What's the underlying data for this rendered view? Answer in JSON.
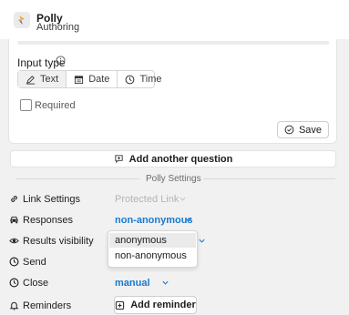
{
  "header": {
    "app_name": "Polly",
    "subtitle": "Authoring"
  },
  "question": {
    "input_type_label": "Input type",
    "input_types": [
      {
        "label": "Text",
        "icon": "pen-icon",
        "selected": true
      },
      {
        "label": "Date",
        "icon": "calendar-icon",
        "selected": false
      },
      {
        "label": "Time",
        "icon": "clock-icon",
        "selected": false
      }
    ],
    "required_label": "Required",
    "required_checked": false,
    "save_label": "Save"
  },
  "add_question_label": "Add another question",
  "settings": {
    "title": "Polly Settings",
    "rows": {
      "link_settings": {
        "label": "Link Settings",
        "value": "Protected Link"
      },
      "responses": {
        "label": "Responses",
        "value": "non-anonymous"
      },
      "results_visibility": {
        "label": "Results visibility"
      },
      "send": {
        "label": "Send"
      },
      "close": {
        "label": "Close",
        "value": "manual"
      },
      "reminders": {
        "label": "Reminders",
        "button_label": "Add reminder"
      }
    },
    "responses_options": [
      "anonymous",
      "non-anonymous"
    ]
  },
  "colors": {
    "accent_blue": "#1b78d0",
    "disabled_text": "#b4b4b4",
    "backdrop": "#f1f1f1"
  }
}
